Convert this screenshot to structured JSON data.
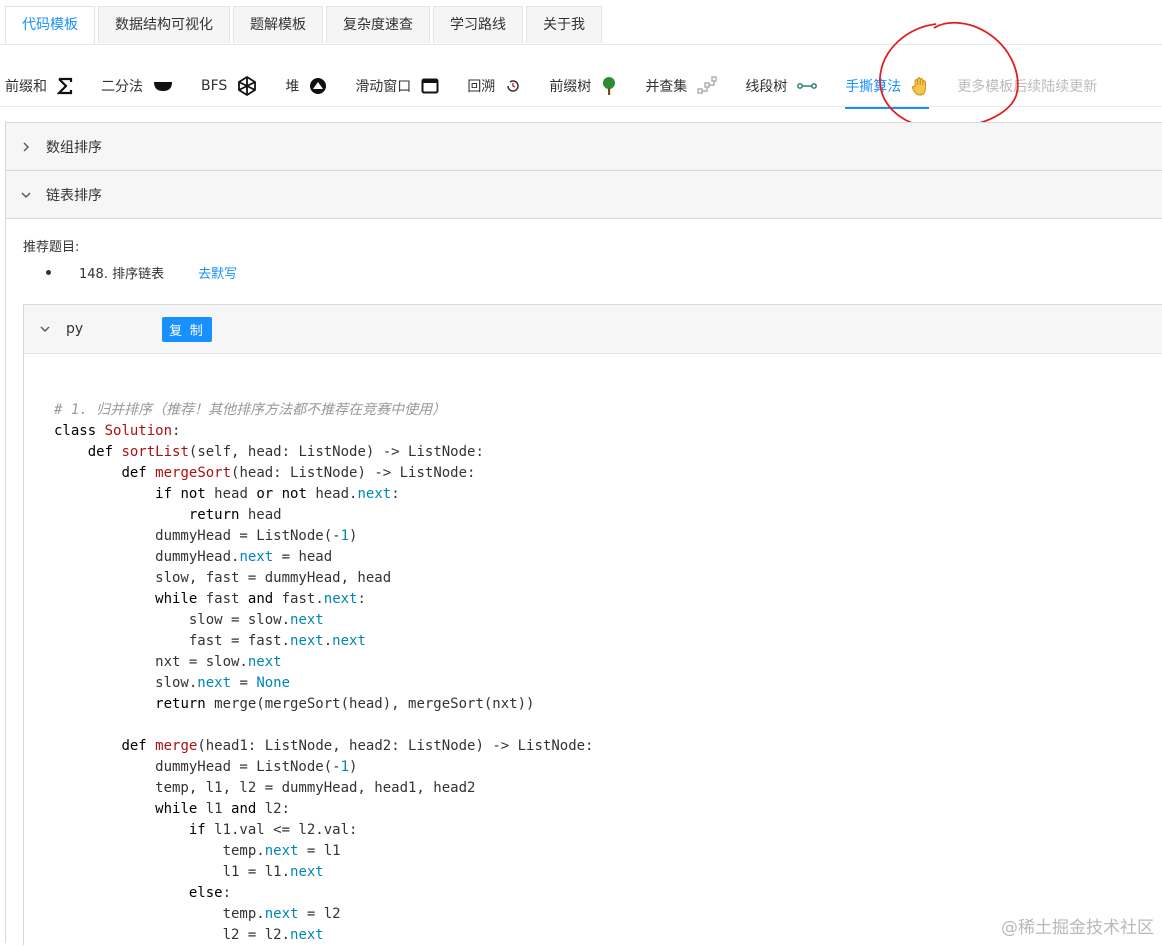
{
  "top_tabs": [
    "代码模板",
    "数据结构可视化",
    "题解模板",
    "复杂度速查",
    "学习路线",
    "关于我"
  ],
  "sub_tabs": [
    {
      "label": "前缀和",
      "icon": "sigma-icon"
    },
    {
      "label": "二分法",
      "icon": "half-circle-icon"
    },
    {
      "label": "BFS",
      "icon": "network-icon"
    },
    {
      "label": "堆",
      "icon": "heap-icon"
    },
    {
      "label": "滑动窗口",
      "icon": "window-icon"
    },
    {
      "label": "回溯",
      "icon": "rewind-clock-icon"
    },
    {
      "label": "前缀树",
      "icon": "tree-icon"
    },
    {
      "label": "并查集",
      "icon": "union-graph-icon"
    },
    {
      "label": "线段树",
      "icon": "segment-icon"
    },
    {
      "label": "手撕算法",
      "icon": "hand-icon"
    },
    {
      "label": "更多模板后续陆续更新",
      "icon": ""
    }
  ],
  "colors": {
    "accent": "#1890ff",
    "annotation": "#e02020"
  },
  "panels": {
    "array_sort": "数组排序",
    "list_sort": "链表排序"
  },
  "recommend": {
    "title": "推荐题目:",
    "item": "148. 排序链表",
    "action": "去默写"
  },
  "code_card": {
    "lang": "py",
    "copy_label": "复 制"
  },
  "watermark": "@稀土掘金技术社区"
}
